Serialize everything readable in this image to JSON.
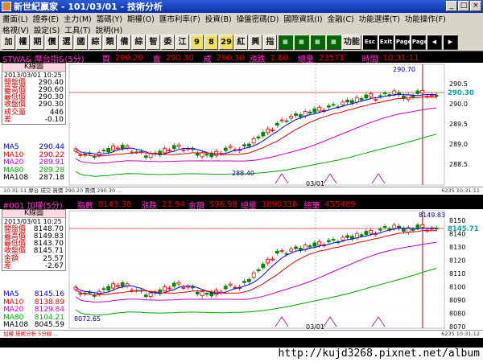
{
  "window": {
    "title": "新世紀贏家 - 101/03/01 - 技術分析",
    "min": "_",
    "max": "□",
    "close": "×"
  },
  "menu": {
    "row1": [
      "畫面(L)",
      "證券(E)",
      "主力(M)",
      "籌碼(Y)",
      "期權(O)",
      "匯市利率(F)",
      "投資(B)",
      "操盤密碼(D)",
      "國際資訊(I)",
      "金融(C)",
      "功能選擇(T)",
      "功能操作(F)"
    ],
    "row2": [
      "格視(V)",
      "設定(S)",
      "工具(T)",
      "說明(H)"
    ]
  },
  "toolbar": [
    "加",
    "權",
    "期",
    "價",
    "選",
    "國",
    "綜",
    "類",
    "備",
    "綜",
    "智",
    "委",
    "江",
    "9",
    "8",
    "29",
    "紅",
    "興",
    "指",
    "▦",
    "▦",
    "▦",
    "▦",
    "功能",
    "Esc",
    "Exit",
    "Page Up",
    "Page Down",
    "◀",
    "▶"
  ],
  "panel1": {
    "symbol": "STWA& 摩台指&(5分)",
    "bid_label": "買",
    "bid": "290.20",
    "ask_label": "賣",
    "ask": "290.30",
    "deal_label": "成",
    "deal": "290.30",
    "chg_label": "漲跌",
    "chg": "1.80",
    "vol_label": "總量",
    "vol": "23571",
    "time_label": "時間",
    "time": "10:31:11",
    "box_title": "K線圖",
    "box_date": "2013/03/01  10:25",
    "rows": [
      {
        "k": "開盤價",
        "v": "290.40"
      },
      {
        "k": "最高價",
        "v": "290.60"
      },
      {
        "k": "最低價",
        "v": "290.30"
      },
      {
        "k": "收盤價",
        "v": "290.30"
      },
      {
        "k": "成交量",
        "v": "446"
      },
      {
        "k": "差",
        "v": "-0.10"
      }
    ],
    "ma": [
      {
        "k": "MA5",
        "v": "290.44",
        "c": "#00f"
      },
      {
        "k": "MA10",
        "v": "290.22",
        "c": "#e00"
      },
      {
        "k": "MA20",
        "v": "289.91",
        "c": "#c0c"
      },
      {
        "k": "MA80",
        "v": "289.28",
        "c": "#0a0"
      },
      {
        "k": "MA108",
        "v": "287.18",
        "c": "#000"
      }
    ],
    "axis": [
      "290.5",
      "290.0",
      "289.5",
      "289.0",
      "288.5"
    ],
    "last": "290.30",
    "hi_label": "290.70",
    "lo_label": "288.40",
    "date_label": "03/01",
    "status": "10:31:11 摩台  成交 買價  290.20  賣價 290.30 ...",
    "status_r": "6235   10:31:11"
  },
  "panel2": {
    "symbol": "#001 加權(5分)",
    "idx_label": "指數",
    "idx": "8143.38",
    "chg_label": "漲跌",
    "chg": "21.94",
    "amt_label": "金額",
    "amt": "596.98",
    "vol_label": "總量",
    "vol": "1890336",
    "cnt_label": "總筆",
    "cnt": "455489",
    "box_title": "K線圖",
    "box_date": "2013/03/01  10:25",
    "rows": [
      {
        "k": "開盤價",
        "v": "8148.70"
      },
      {
        "k": "最高價",
        "v": "8149.83"
      },
      {
        "k": "最低價",
        "v": "8143.70"
      },
      {
        "k": "收盤價",
        "v": "8145.71"
      },
      {
        "k": "金額",
        "v": "25.57"
      },
      {
        "k": "差",
        "v": "-2.67"
      }
    ],
    "ma": [
      {
        "k": "MA5",
        "v": "8145.16",
        "c": "#00f"
      },
      {
        "k": "MA10",
        "v": "8138.89",
        "c": "#e00"
      },
      {
        "k": "MA20",
        "v": "8129.84",
        "c": "#c0c"
      },
      {
        "k": "MA80",
        "v": "8104.21",
        "c": "#0a0"
      },
      {
        "k": "MA108",
        "v": "8045.59",
        "c": "#000"
      }
    ],
    "axis": [
      "8150",
      "8140",
      "8130",
      "8120",
      "8110",
      "8100",
      "8090",
      "8080",
      "8070"
    ],
    "last": "8145.71",
    "hi_label": "8149.83",
    "lo_label": "8072.65",
    "date_label": "03/01",
    "status": "加權  技術分析 5分線 ...",
    "status_r": "6235   10:31:12"
  },
  "footer": {
    "url": "http://kujd3268.pixnet.net/album"
  },
  "colors": {
    "up": "#e00",
    "down": "#0a0",
    "ma5": "#00f",
    "ma10": "#e00",
    "ma20": "#c0c",
    "ma80": "#0a0"
  }
}
